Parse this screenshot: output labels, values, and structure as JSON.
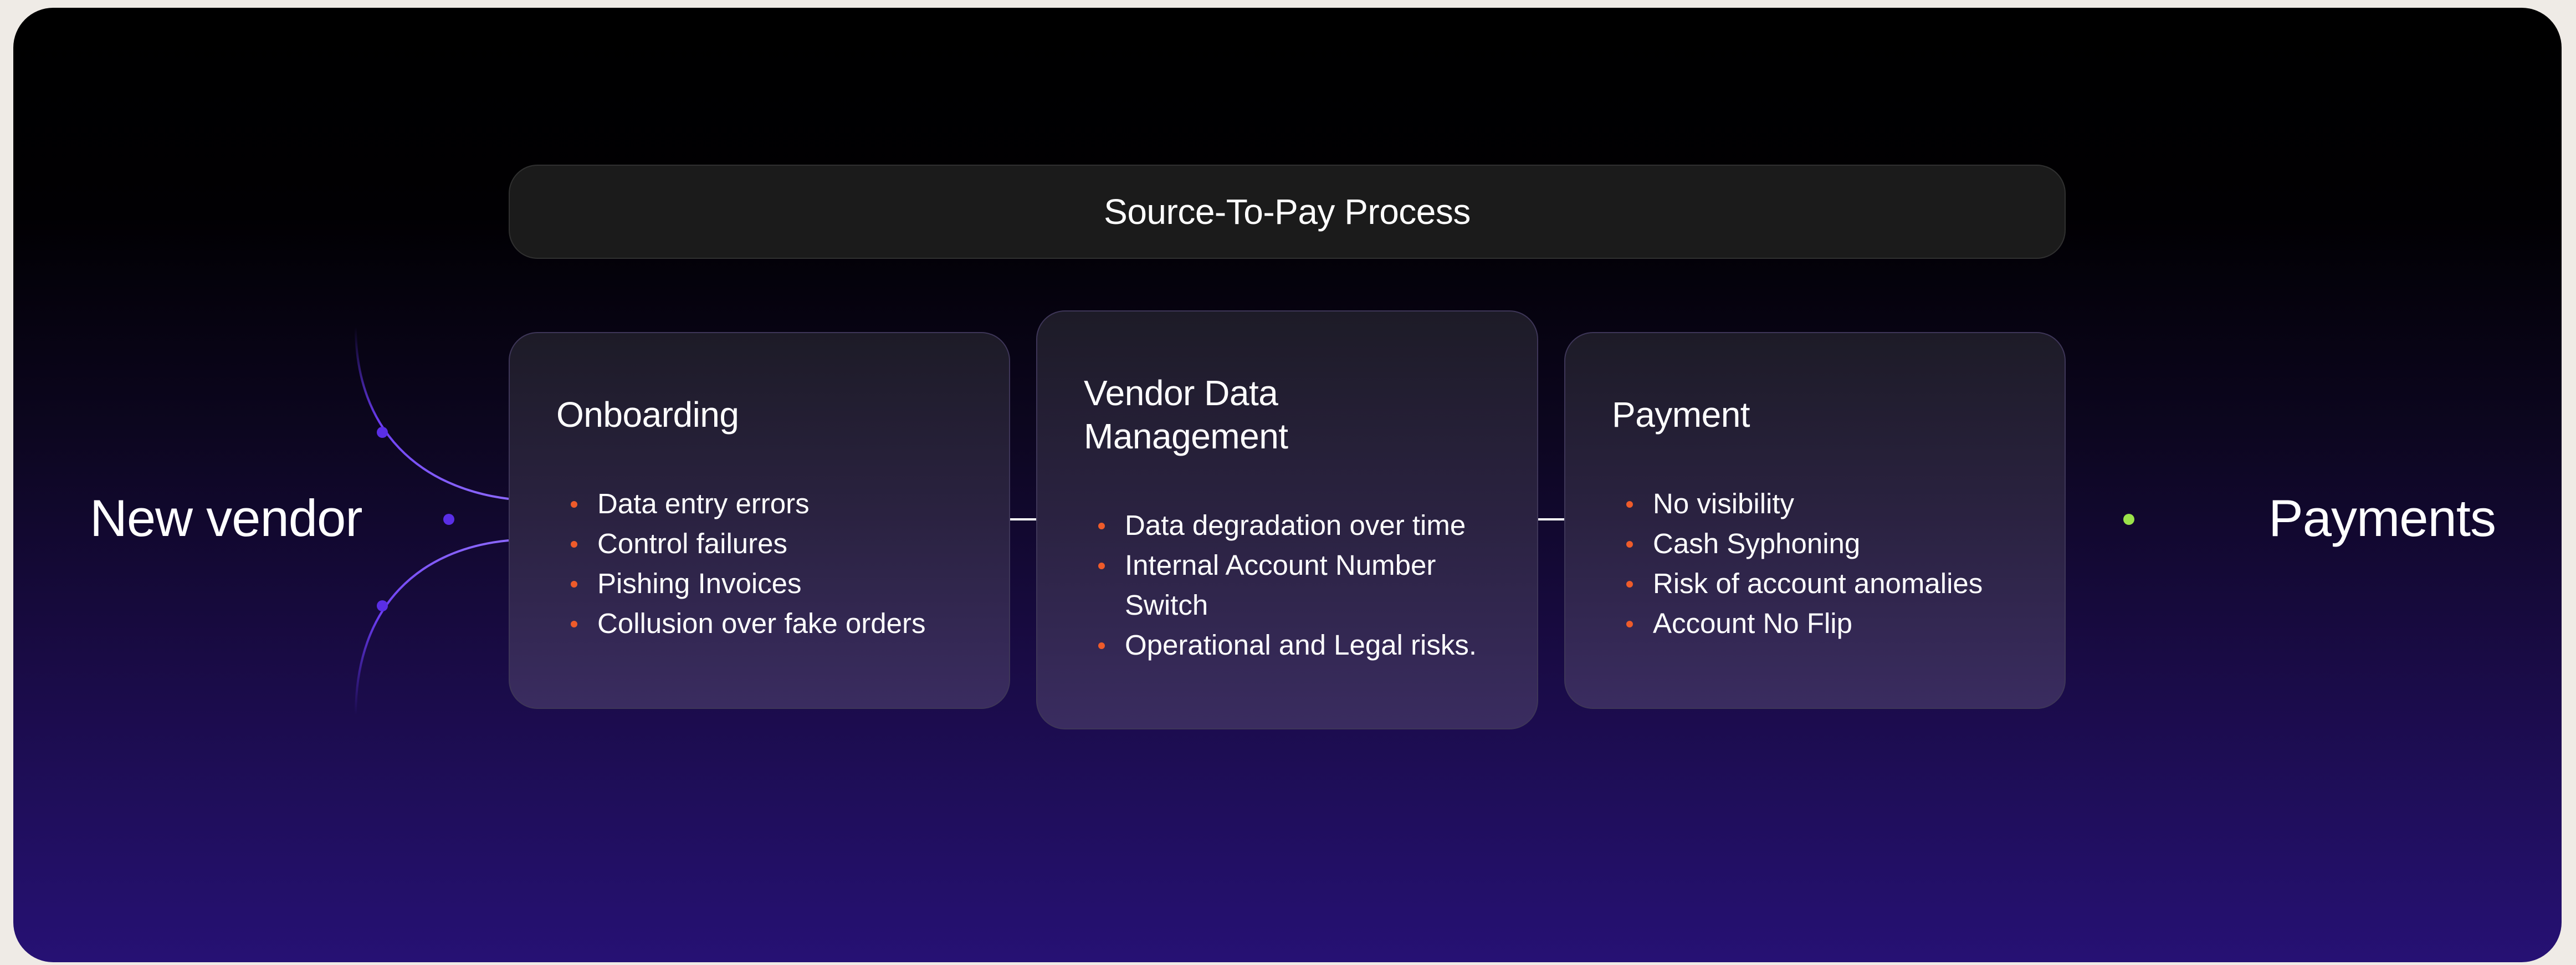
{
  "diagram": {
    "source_label": "New vendor",
    "target_label": "Payments",
    "header_title": "Source-To-Pay Process",
    "stages": [
      {
        "title": "Onboarding",
        "items": [
          "Data entry errors",
          "Control failures",
          "Pishing Invoices",
          "Collusion over fake orders"
        ]
      },
      {
        "title": "Vendor Data Management",
        "items": [
          "Data degradation over time",
          "Internal Account Number Switch",
          "Operational and Legal risks."
        ]
      },
      {
        "title": "Payment",
        "items": [
          "No visibility",
          "Cash Syphoning",
          "Risk of account anomalies",
          "Account No Flip"
        ]
      }
    ],
    "colors": {
      "bullet": "#ee5b2a",
      "input_connector": "#5a2ee6",
      "output_connector": "#9be24a",
      "stage_link": "#ffffff"
    }
  }
}
